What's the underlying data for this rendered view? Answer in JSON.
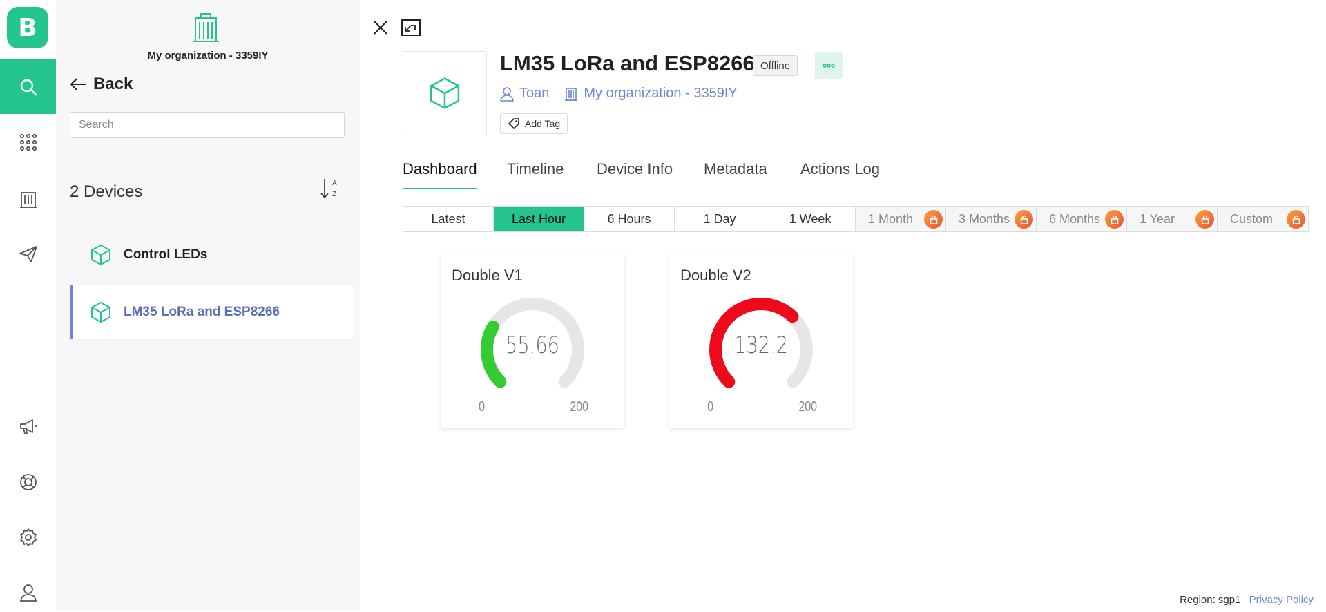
{
  "app": {
    "logo_letter": "B",
    "accent": "#23c48e",
    "link_color": "#6e86d9"
  },
  "rail": {
    "items": [
      {
        "name": "search-icon",
        "active": true
      },
      {
        "name": "dashboard-grid-icon"
      },
      {
        "name": "organization-icon"
      },
      {
        "name": "send-icon"
      },
      {
        "name": "announcement-icon"
      },
      {
        "name": "help-lifebuoy-icon"
      },
      {
        "name": "settings-gear-icon"
      },
      {
        "name": "user-profile-icon"
      }
    ]
  },
  "panel": {
    "org_name": "My organization - 3359IY",
    "back_label": "Back",
    "search_placeholder": "Search",
    "device_count": "2 Devices",
    "sort_icon": "sort-alpha-icon",
    "devices": [
      {
        "label": "Control LEDs",
        "active": false
      },
      {
        "label": "LM35 LoRa and ESP8266",
        "active": true
      }
    ]
  },
  "device": {
    "title": "LM35 LoRa and ESP8266",
    "status": "Offline",
    "owner": "Toan",
    "organization": "My organization - 3359IY",
    "add_tag": "Add Tag"
  },
  "tabs": [
    "Dashboard",
    "Timeline",
    "Device Info",
    "Metadata",
    "Actions Log"
  ],
  "active_tab": "Dashboard",
  "ranges": [
    {
      "label": "Latest"
    },
    {
      "label": "Last Hour",
      "selected": true
    },
    {
      "label": "6 Hours"
    },
    {
      "label": "1 Day"
    },
    {
      "label": "1 Week"
    },
    {
      "label": "1 Month",
      "locked": true
    },
    {
      "label": "3 Months",
      "locked": true
    },
    {
      "label": "6 Months",
      "locked": true
    },
    {
      "label": "1 Year",
      "locked": true
    },
    {
      "label": "Custom",
      "locked": true
    }
  ],
  "widgets": [
    {
      "title": "Double V1",
      "value": "55.66",
      "min": "0",
      "max": "200",
      "value_num": 55.66,
      "color": "#33cc33"
    },
    {
      "title": "Double V2",
      "value": "132.2",
      "min": "0",
      "max": "200",
      "value_num": 132.2,
      "color": "#ee0a1a"
    }
  ],
  "footer": {
    "region": "Region: sgp1",
    "privacy": "Privacy Policy"
  }
}
